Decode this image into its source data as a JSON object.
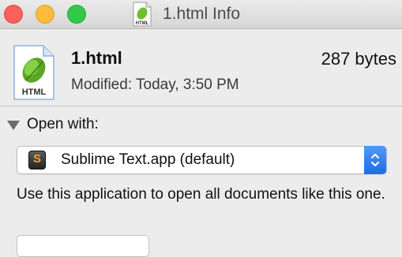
{
  "window": {
    "title": "1.html Info",
    "title_icon": "html-document-icon"
  },
  "file": {
    "name": "1.html",
    "size": "287 bytes",
    "modified": "Modified: Today, 3:50 PM",
    "icon_label": "HTML"
  },
  "open_with": {
    "section_label": "Open with:",
    "expanded": true,
    "selected_app": "Sublime Text.app (default)",
    "app_icon_letter": "S",
    "description": "Use this application to open all documents like this one."
  },
  "colors": {
    "accent": "#1f6ce5",
    "close": "#fc605c",
    "minimize": "#fdbc40",
    "zoom": "#34c84a"
  }
}
